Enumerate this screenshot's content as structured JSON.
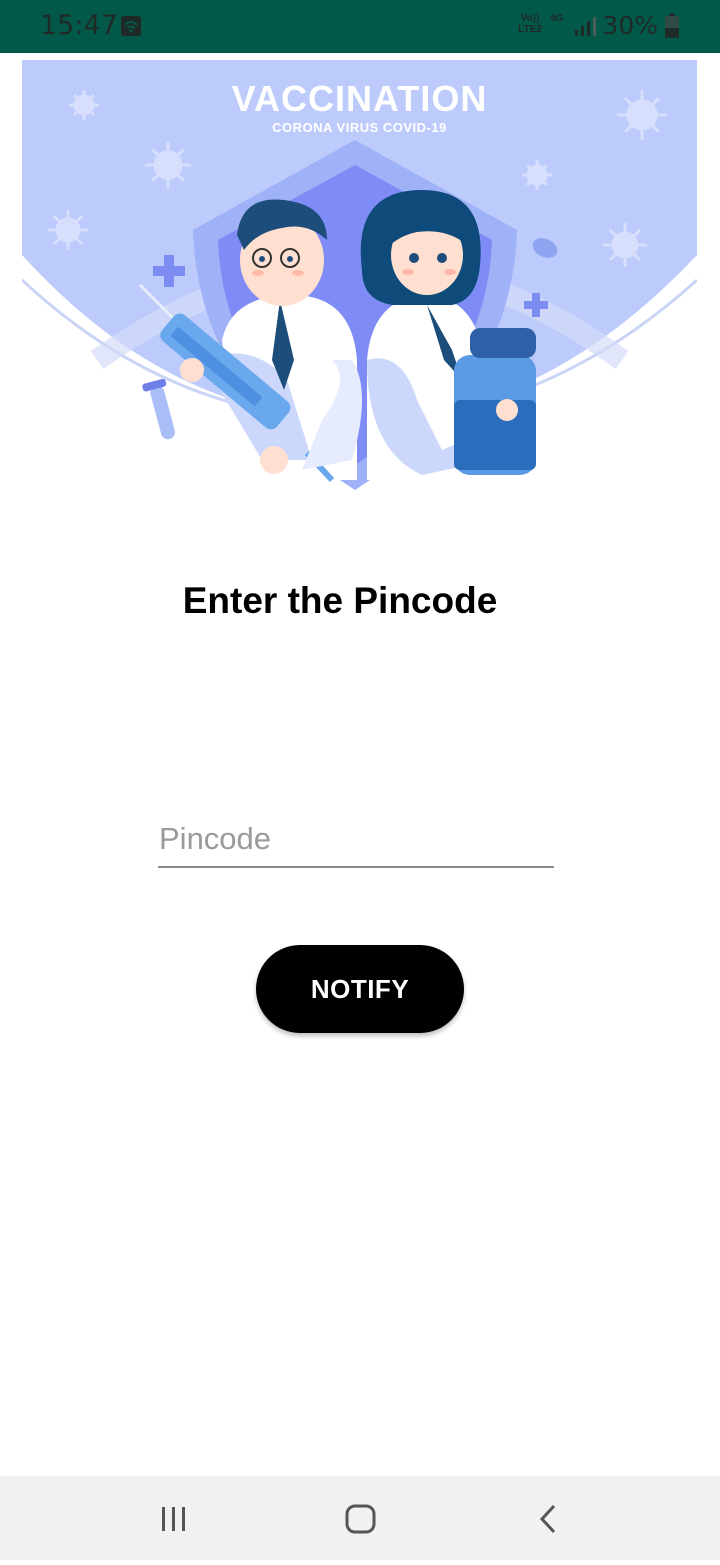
{
  "status_bar": {
    "time": "15:47",
    "network_top": "Vo))",
    "network_bottom": "LTE2",
    "network_type": "4G",
    "battery": "30%",
    "icons": [
      "sim-icon",
      "wifi-icon",
      "signal-icon",
      "battery-icon"
    ]
  },
  "banner": {
    "title": "VACCINATION",
    "subtitle": "CORONA VIRUS COVID-19"
  },
  "form": {
    "heading": "Enter the Pincode",
    "pincode_placeholder": "Pincode",
    "pincode_value": "",
    "notify_label": "NOTIFY"
  },
  "nav": {
    "buttons": [
      "recent-apps-icon",
      "home-icon",
      "back-icon"
    ]
  },
  "colors": {
    "status_bar": "#02594a",
    "banner_bg": "#bccbfb",
    "button": "#000000",
    "nav_bar": "#f1f1f1"
  }
}
